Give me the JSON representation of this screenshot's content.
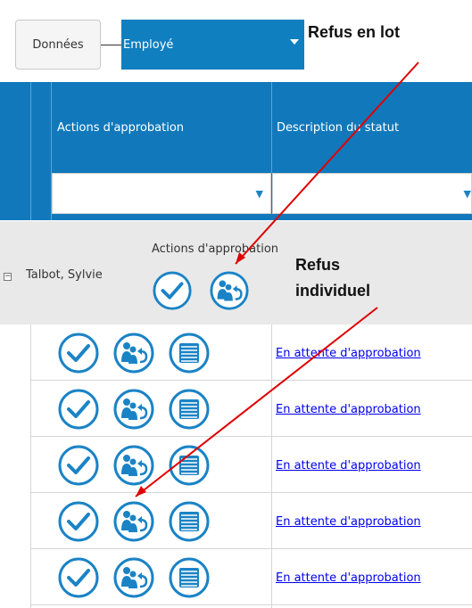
{
  "toolbar": {
    "data_button_label": "Données",
    "employee_select_value": "Employé"
  },
  "callouts": {
    "batch_refusal": "Refus en lot",
    "individual_refusal_line1": "Refus",
    "individual_refusal_line2": "individuel"
  },
  "grid": {
    "columns": [
      "Actions d'approbation",
      "Description du statut"
    ],
    "group": {
      "name": "Talbot, Sylvie",
      "actions_label": "Actions d'approbation",
      "toggle": "−"
    },
    "rows": [
      {
        "status": "En attente d'approbation"
      },
      {
        "status": "En attente d'approbation"
      },
      {
        "status": "En attente d'approbation"
      },
      {
        "status": "En attente d'approbation"
      },
      {
        "status": "En attente d'approbation"
      }
    ]
  },
  "colors": {
    "accent": "#1179bb",
    "icon": "#1a83c6",
    "arrow": "#e00000",
    "group_background": "#e9e9e9"
  },
  "icons": [
    "approve-check-icon",
    "refuse-return-icon",
    "details-list-icon",
    "filter-icon"
  ]
}
